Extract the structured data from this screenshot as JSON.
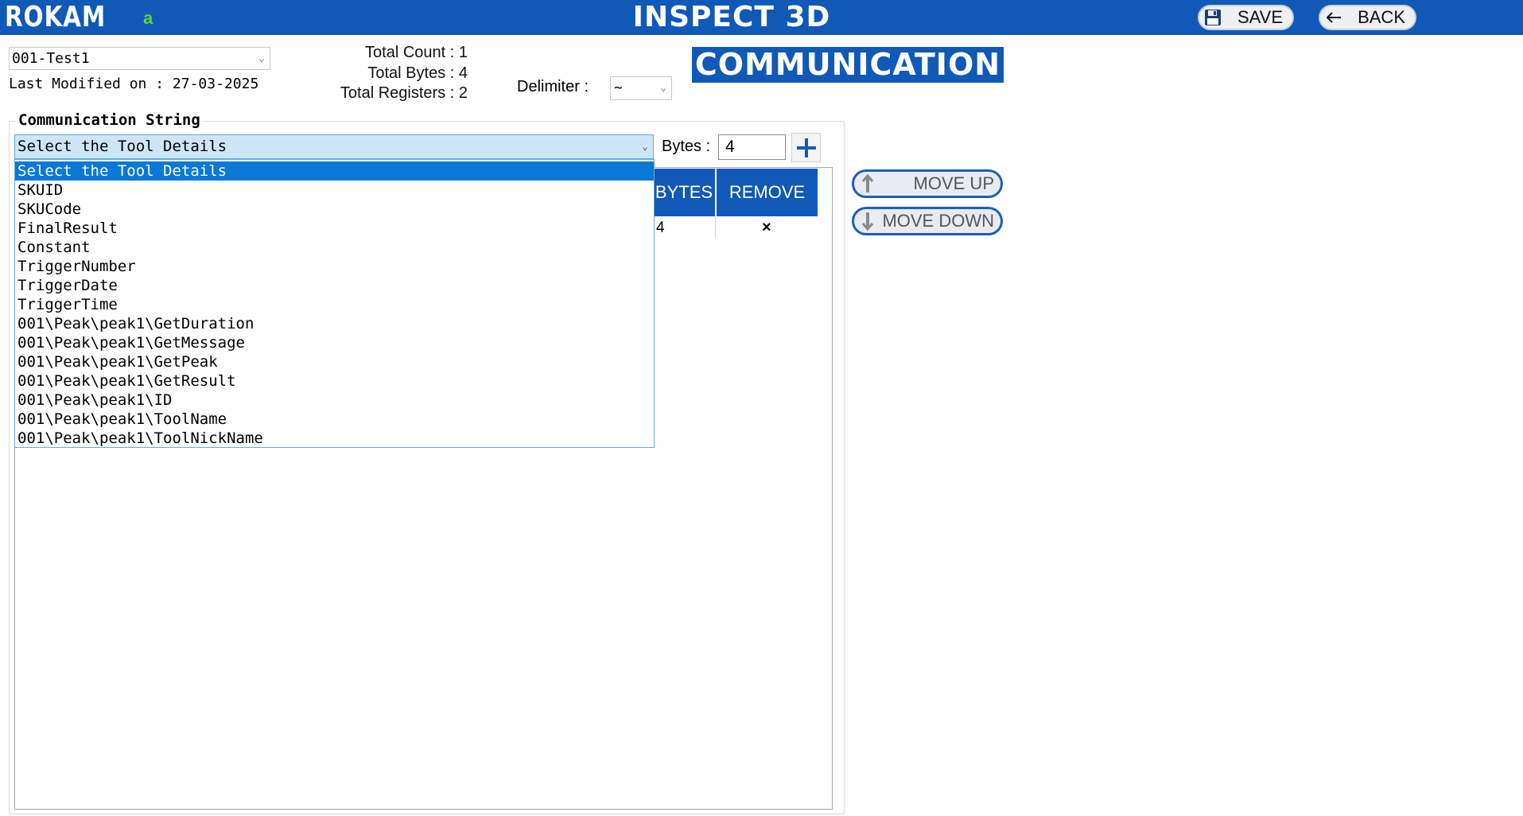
{
  "header": {
    "logo_text": "ROKAM",
    "user_tag": "a",
    "app_title": "INSPECT 3D",
    "save_label": "SAVE",
    "back_label": "BACK",
    "save_icon": "floppy-disk-icon",
    "back_icon": "arrow-left-icon",
    "bar_color": "#1059b7"
  },
  "file": {
    "selected": "001-Test1",
    "last_modified_label": "Last Modified on :",
    "last_modified_value": "27-03-2025"
  },
  "stats": {
    "total_count_label": "Total Count :",
    "total_count": "1",
    "total_bytes_label": "Total Bytes :",
    "total_bytes": "4",
    "total_registers_label": "Total Registers :",
    "total_registers": "2"
  },
  "delimiter": {
    "label": "Delimiter :",
    "value": "~"
  },
  "section_title": "COMMUNICATION",
  "comm_string": {
    "group_label": "Communication String",
    "tool_select_value": "Select the Tool Details",
    "bytes_label": "Bytes :",
    "bytes_value": "4",
    "add_icon": "plus-icon",
    "dropdown_options": [
      "Select the Tool Details",
      "SKUID",
      "SKUCode",
      "FinalResult",
      "Constant",
      "TriggerNumber",
      "TriggerDate",
      "TriggerTime",
      "001\\Peak\\peak1\\GetDuration",
      "001\\Peak\\peak1\\GetMessage",
      "001\\Peak\\peak1\\GetPeak",
      "001\\Peak\\peak1\\GetResult",
      "001\\Peak\\peak1\\ID",
      "001\\Peak\\peak1\\ToolName",
      "001\\Peak\\peak1\\ToolNickName"
    ],
    "table": {
      "headers": [
        "BYTES",
        "REMOVE"
      ],
      "rows": [
        {
          "bytes": "4",
          "remove": "×"
        }
      ]
    }
  },
  "side_buttons": {
    "move_up_label": "MOVE UP",
    "move_down_label": "MOVE DOWN",
    "move_up_icon": "arrow-up-icon",
    "move_down_icon": "arrow-down-icon"
  }
}
